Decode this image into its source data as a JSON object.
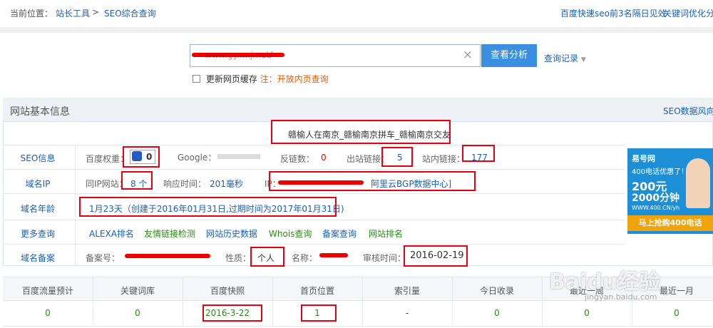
{
  "breadcrumb": {
    "prefix": "当前位置：",
    "tool": "站长工具",
    "sep": ">",
    "current": "SEO综合查询"
  },
  "top_right": {
    "link1": "百度快速seo前3名隔日见效",
    "link2": "关键词优化分"
  },
  "search": {
    "value": "www.gy.....j.net/",
    "button": "查看分析",
    "history": "查询记录",
    "cache_label": "更新网页缓存",
    "cache_note": "注：开放内页查询"
  },
  "panel": {
    "title": "网站基本信息",
    "right_link": "SEO数据风向",
    "site_title": "赣榆人在南京_赣榆南京拼车_赣榆南京交友"
  },
  "rows": {
    "seo": {
      "label": "SEO信息",
      "baidu_weight_label": "百度权重：",
      "baidu_weight_value": "0",
      "google_label": "Google：",
      "backlinks_label": "反链数：",
      "backlinks_value": "0",
      "outlinks_label": "出站链接：",
      "outlinks_value": "5",
      "inlinks_label": "站内链接：",
      "inlinks_value": "177"
    },
    "ip": {
      "label": "域名IP",
      "same_ip_label": "同IP网站：",
      "same_ip_value": "8 个",
      "resp_label": "响应时间：",
      "resp_value": "201毫秒",
      "ip_label": "IP：",
      "ip_location": "阿里云BGP数据中心]"
    },
    "age": {
      "label": "域名年龄",
      "value": "1月23天（创建于2016年01月31日,过期时间为2017年01月31日)"
    },
    "more": {
      "label": "更多查询",
      "links": [
        "ALEXA排名",
        "友情链接检测",
        "网站历史数据",
        "Whois查询",
        "备案查询",
        "网站排名"
      ]
    },
    "icp": {
      "label": "域名备案",
      "icp_label": "备案号：",
      "nature_label": "性质：",
      "nature_value": "个人",
      "name_label": "名称：",
      "review_label": "审核时间：",
      "review_value": "2016-02-19"
    }
  },
  "ad": {
    "brand": "易号网",
    "line1": "400电话优惠了！",
    "price1": "200元",
    "price2": "2000分钟",
    "url": "WWW.400.CN/yh",
    "cta": "马上抢购400电话"
  },
  "table": {
    "headers": [
      "百度流量预计",
      "关键词库",
      "百度快照",
      "首页位置",
      "索引量",
      "今日收录",
      "最近一周",
      "最近一月"
    ],
    "values": [
      "0",
      "0",
      "2016-3-22",
      "1",
      "-",
      "0",
      "0",
      "0"
    ]
  },
  "watermark": {
    "text": "Baidu经验",
    "sub": "jingyan.baidu.com"
  },
  "colors": {
    "link": "#1a5fb4",
    "highlight": "#e60012",
    "green": "#2a8c16",
    "button": "#3b8fe0"
  }
}
